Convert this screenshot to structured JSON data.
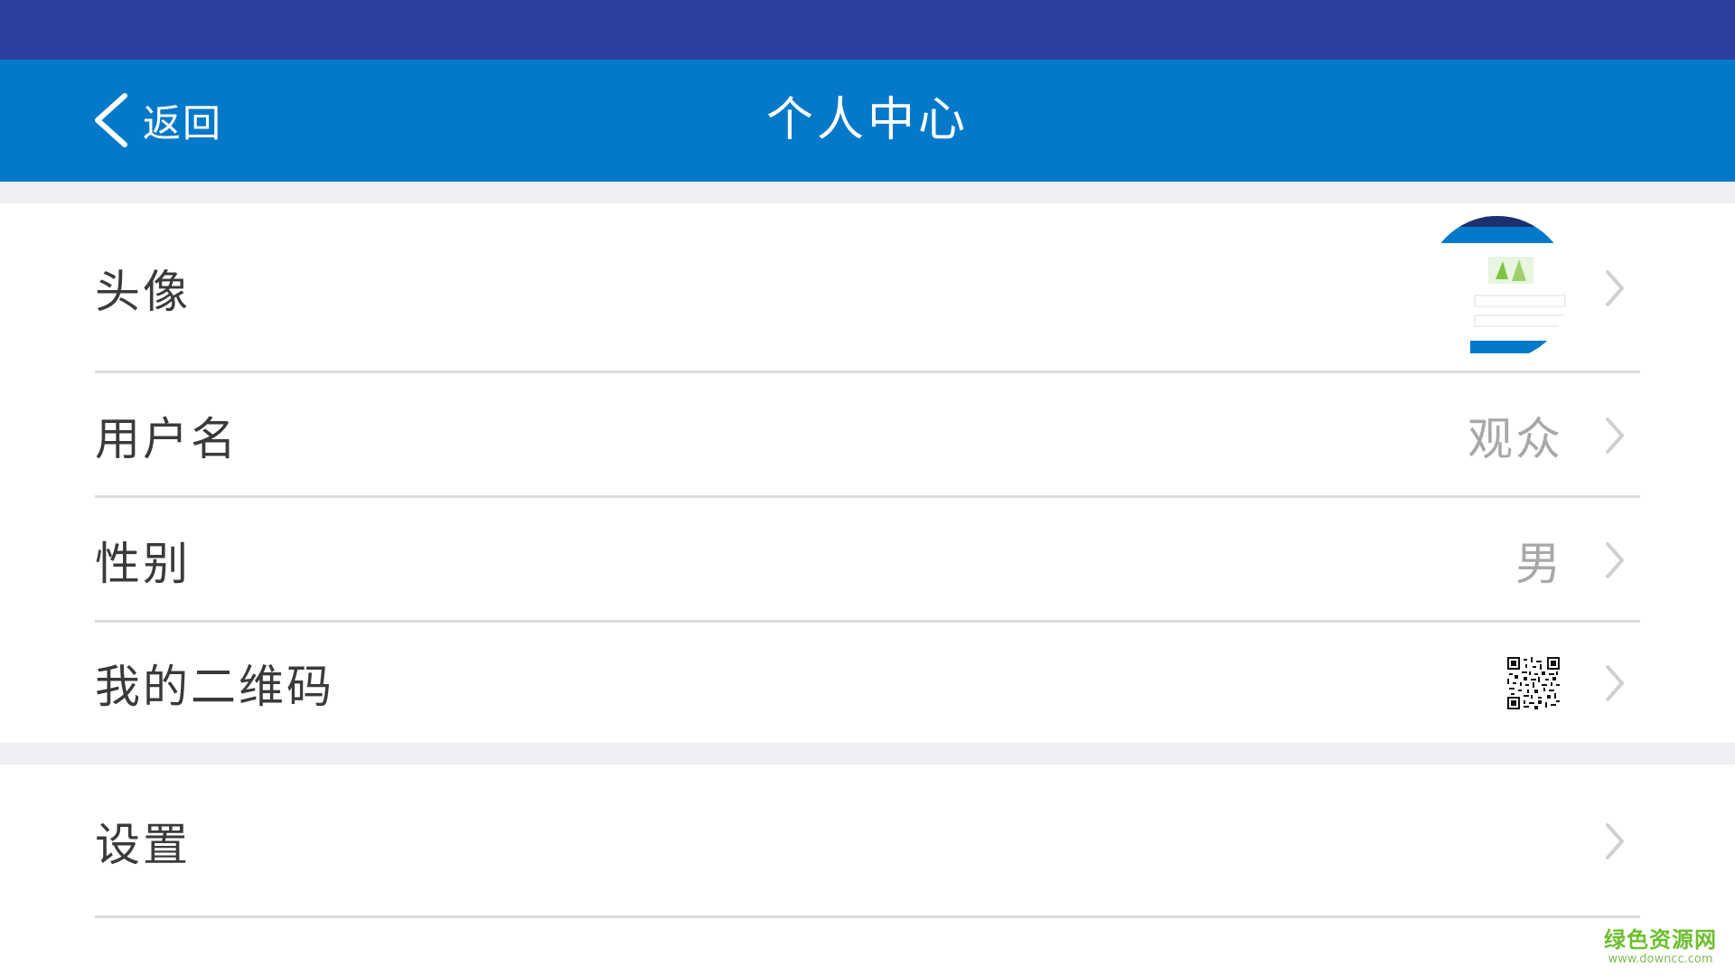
{
  "header": {
    "back_label": "返回",
    "title": "个人中心"
  },
  "rows": {
    "avatar": {
      "label": "头像"
    },
    "username": {
      "label": "用户名",
      "value": "观众"
    },
    "gender": {
      "label": "性别",
      "value": "男"
    },
    "qrcode": {
      "label": "我的二维码"
    },
    "settings": {
      "label": "设置"
    }
  },
  "watermark": {
    "main": "绿色资源网",
    "sub": "www.downcc.com"
  },
  "colors": {
    "status_bar": "#2f3f9e",
    "nav_bar": "#0579c9",
    "background_gap": "#eeeef3",
    "value_text": "#a8a8a8",
    "watermark": "#6cbf2e"
  },
  "icons": {
    "back": "chevron-left-icon",
    "row_arrow": "chevron-right-icon",
    "qr": "qr-code-icon"
  }
}
